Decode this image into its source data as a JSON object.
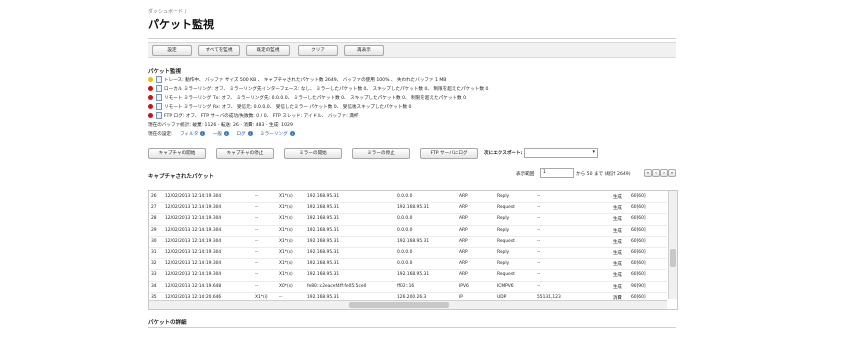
{
  "breadcrumb": "ダッシュボード /",
  "page_title": "パケット監視",
  "toolbar": [
    "設定",
    "すべてを監視",
    "既定の監視",
    "クリア",
    "再表示"
  ],
  "monitor": {
    "title": "パケット監視",
    "lines": [
      {
        "status": "yellow",
        "text": "トレース: 動作中、 バッファ サイズ 500 KB 、 キャプチャされたパケット数 2649、 バッファの使用 100% 、 失われたバッファ 1 MB"
      },
      {
        "status": "red",
        "text": "ローカル ミラーリング: オフ、 ミラーリング先インターフェース: なし、 ミラーしたパケット数 0、 スキップしたパケット数 0、 制限を超えたパケット数 0"
      },
      {
        "status": "red",
        "text": "リモート ミラーリング Tx: オフ、 ミラーリング先: 0.0.0.0、 ミラーしたパケット数 0、 スキップしたパケット数 0、 制限を超えたパケット数 0"
      },
      {
        "status": "red",
        "text": "リモート ミラーリング Rx: オフ、 受信元: 0.0.0.0、 受信したミラー パケット数 0、 受信後スキップしたパケット数 0"
      },
      {
        "status": "red",
        "text": "FTP ログ: オフ、 FTP サーバの成功/失敗数: 0 / 0、 FTP スレッド: アイドル、 バッファ: 満杯"
      }
    ],
    "buffer_stats": "現在のバッファ統計: 破棄: 1126 - 転送: 26 - 消費: 483 - 生成: 1029",
    "settings_label": "現在の設定:",
    "settings_links": [
      "フィルタ",
      "一般",
      "ログ",
      "ミラーリング"
    ]
  },
  "capture_buttons": [
    "キャプチャの開始",
    "キャプチャの停止",
    "ミラーの開始",
    "ミラーの停止",
    "FTP サーバにログ"
  ],
  "export_label": "次にエクスポート:",
  "captured": {
    "title": "キャプチャされたパケット",
    "range_label": "表示範囲",
    "range_value": "1",
    "range_text": "から 50 まで (総計 2649)",
    "rows": [
      {
        "no": "26",
        "time": "12/02/2013 12:14:19.304",
        "in": "--",
        "out": "X1*(s)",
        "src": "192.168.95.31",
        "dst": "0.0.0.0",
        "proto": "ARP",
        "info": "Reply",
        "port": "--",
        "status": "生成",
        "size": "60[60]"
      },
      {
        "no": "27",
        "time": "12/02/2013 12:14:19.304",
        "in": "--",
        "out": "X1*(s)",
        "src": "192.168.95.31",
        "dst": "192.168.95.31",
        "proto": "ARP",
        "info": "Request",
        "port": "--",
        "status": "生成",
        "size": "60[60]"
      },
      {
        "no": "28",
        "time": "12/02/2013 12:14:19.304",
        "in": "--",
        "out": "X1*(s)",
        "src": "192.168.95.31",
        "dst": "0.0.0.0",
        "proto": "ARP",
        "info": "Reply",
        "port": "--",
        "status": "生成",
        "size": "60[60]"
      },
      {
        "no": "29",
        "time": "12/02/2013 12:14:19.304",
        "in": "--",
        "out": "X1*(s)",
        "src": "192.168.95.31",
        "dst": "0.0.0.0",
        "proto": "ARP",
        "info": "Reply",
        "port": "--",
        "status": "生成",
        "size": "60[60]"
      },
      {
        "no": "30",
        "time": "12/02/2013 12:14:19.304",
        "in": "--",
        "out": "X1*(s)",
        "src": "192.168.95.31",
        "dst": "192.168.95.31",
        "proto": "ARP",
        "info": "Request",
        "port": "--",
        "status": "生成",
        "size": "60[60]"
      },
      {
        "no": "31",
        "time": "12/02/2013 12:14:19.304",
        "in": "--",
        "out": "X1*(s)",
        "src": "192.168.95.31",
        "dst": "0.0.0.0",
        "proto": "ARP",
        "info": "Reply",
        "port": "--",
        "status": "生成",
        "size": "60[60]"
      },
      {
        "no": "32",
        "time": "12/02/2013 12:14:19.304",
        "in": "--",
        "out": "X1*(s)",
        "src": "192.168.95.31",
        "dst": "0.0.0.0",
        "proto": "ARP",
        "info": "Reply",
        "port": "--",
        "status": "生成",
        "size": "60[60]"
      },
      {
        "no": "33",
        "time": "12/02/2013 12:14:19.304",
        "in": "--",
        "out": "X1*(s)",
        "src": "192.168.95.31",
        "dst": "192.168.95.31",
        "proto": "ARP",
        "info": "Request",
        "port": "--",
        "status": "生成",
        "size": "60[60]"
      },
      {
        "no": "34",
        "time": "12/02/2013 12:14:19.648",
        "in": "--",
        "out": "X0*(s)",
        "src": "fe80::c2eacef4ff:fe05:5ce0",
        "dst": "ff02::16",
        "proto": "IPV6",
        "info": "ICMPV6",
        "port": "--",
        "status": "生成",
        "size": "90[90]"
      },
      {
        "no": "35",
        "time": "12/02/2013 12:14:20.646",
        "in": "X1*(i)",
        "out": "--",
        "src": "192.168.95.31",
        "dst": "126.200.26.3",
        "proto": "IP",
        "info": "UDP",
        "port": "55131,123",
        "status": "消費",
        "size": "60[60]"
      }
    ]
  },
  "details_title": "パケットの詳細",
  "colors": {
    "yellow": "#e8c400",
    "red": "#d01010",
    "link": "#1c4fa0"
  }
}
